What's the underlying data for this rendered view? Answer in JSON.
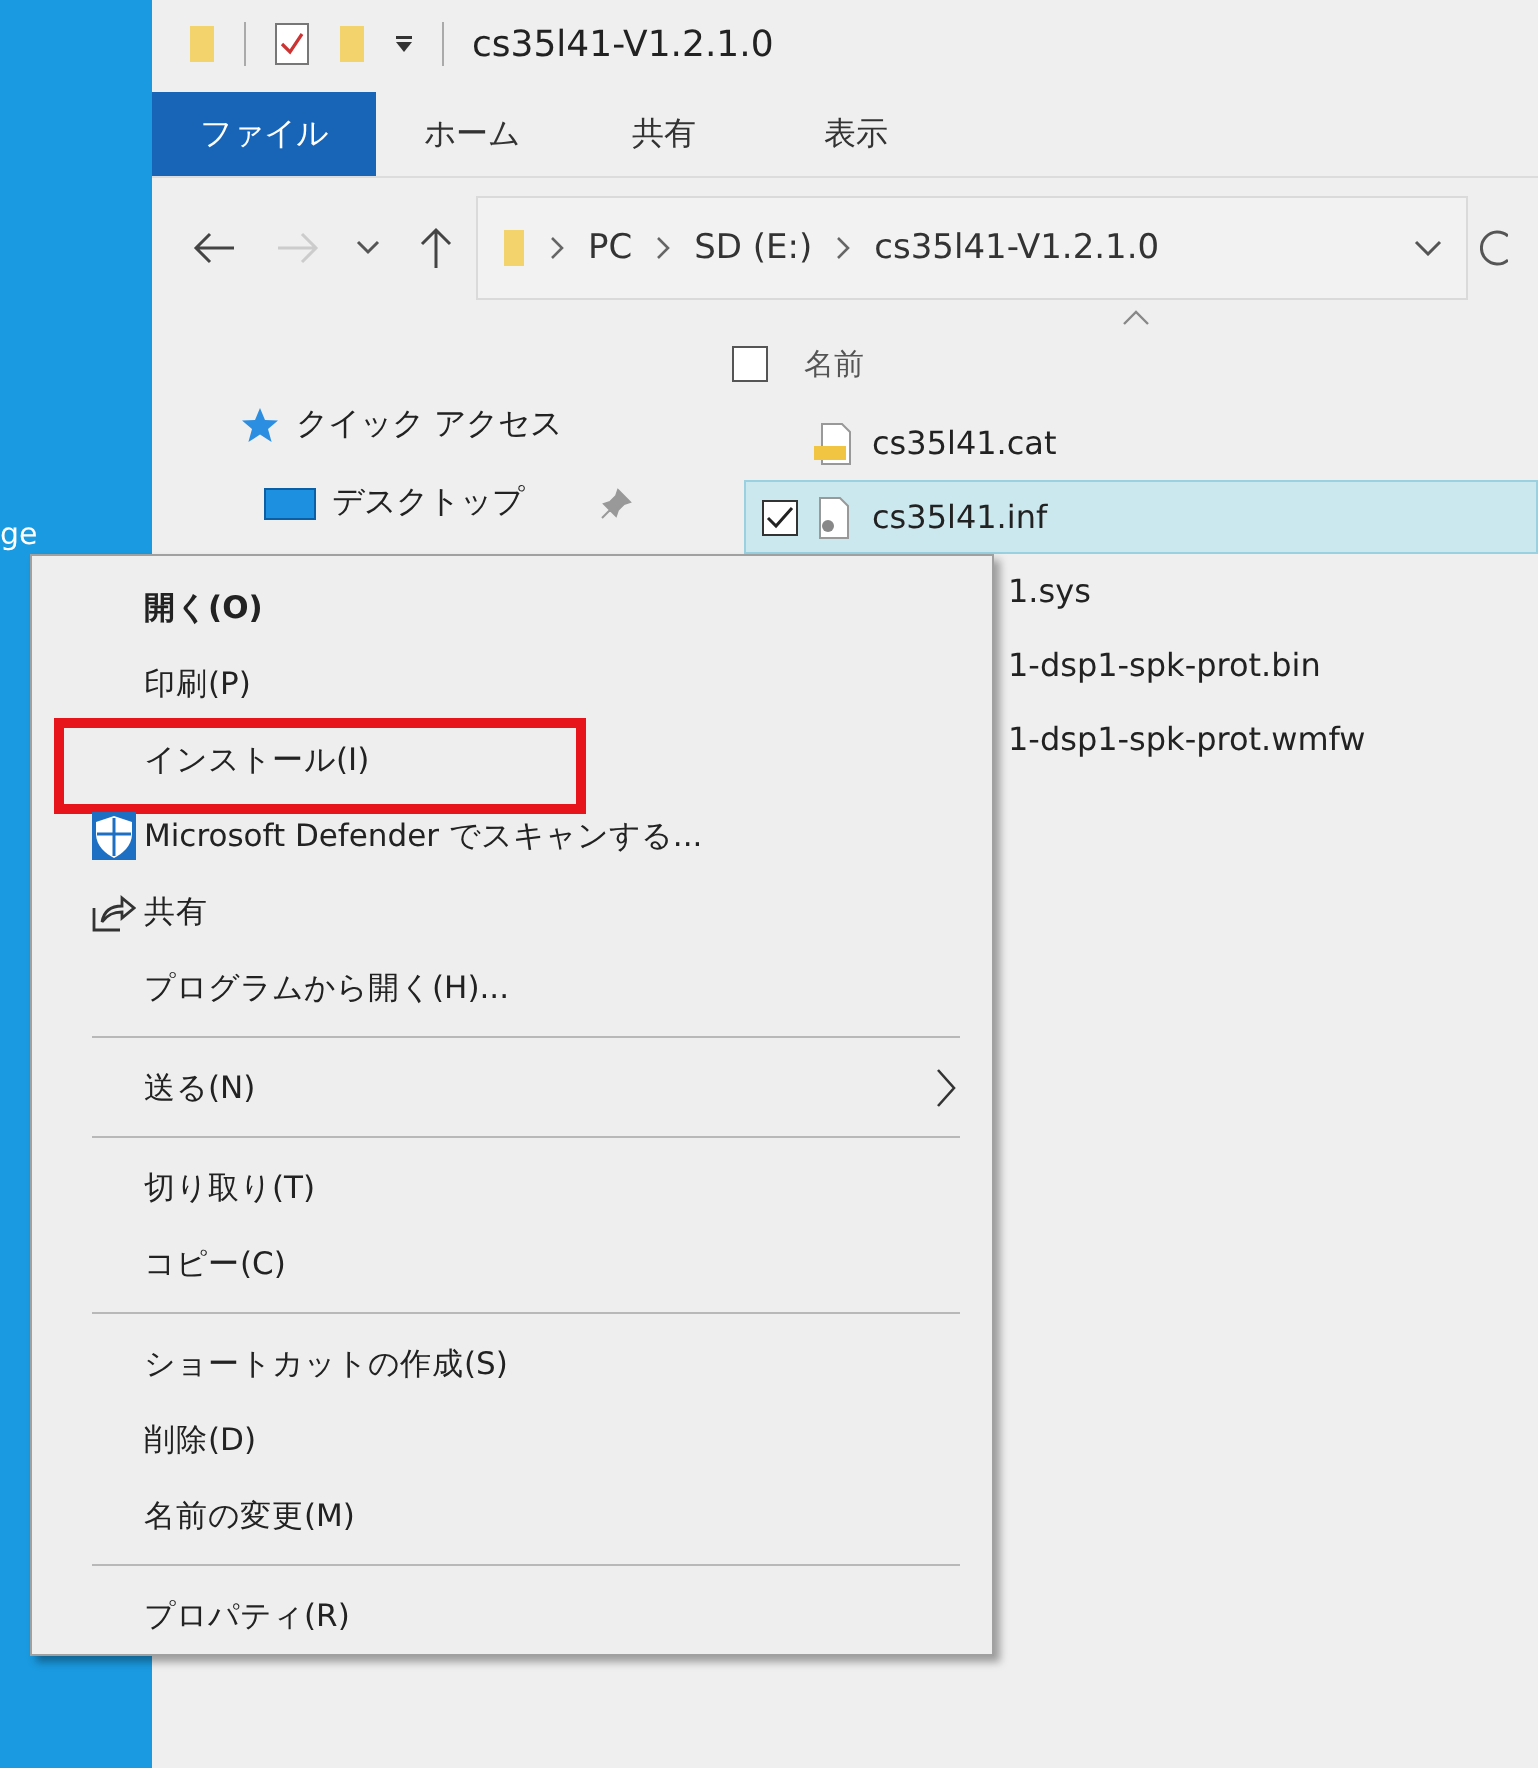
{
  "desktop": {
    "icon_label": "ge"
  },
  "window": {
    "title": "cs35l41-V1.2.1.0"
  },
  "ribbon_tabs": [
    {
      "label": "ファイル",
      "selected": true
    },
    {
      "label": "ホーム",
      "selected": false
    },
    {
      "label": "共有",
      "selected": false
    },
    {
      "label": "表示",
      "selected": false
    }
  ],
  "address_bar": {
    "crumbs": [
      "PC",
      "SD (E:)",
      "cs35l41-V1.2.1.0"
    ]
  },
  "navigation": [
    {
      "label": "クイック アクセス",
      "kind": "star"
    },
    {
      "label": "デスクトップ",
      "kind": "desktop",
      "pinned": true
    }
  ],
  "file_list": {
    "column": "名前",
    "all_checked": false,
    "rows": [
      {
        "name": "cs35l41.cat",
        "kind": "catalog",
        "selected": false,
        "checked": false
      },
      {
        "name": "cs35l41.inf",
        "kind": "settings",
        "selected": true,
        "checked": true
      },
      {
        "name": "1.sys",
        "kind": "covered",
        "selected": false,
        "checked": false
      },
      {
        "name": "1-dsp1-spk-prot.bin",
        "kind": "covered",
        "selected": false,
        "checked": false
      },
      {
        "name": "1-dsp1-spk-prot.wmfw",
        "kind": "covered",
        "selected": false,
        "checked": false
      }
    ]
  },
  "context_menu": [
    {
      "kind": "item",
      "label": "開く(O)",
      "bold": true
    },
    {
      "kind": "item",
      "label": "印刷(P)"
    },
    {
      "kind": "item",
      "label": "インストール(I)",
      "highlighted": true
    },
    {
      "kind": "defender",
      "label": "Microsoft Defender でスキャンする..."
    },
    {
      "kind": "share",
      "label": "共有"
    },
    {
      "kind": "item",
      "label": "プログラムから開く(H)..."
    },
    {
      "kind": "separator"
    },
    {
      "kind": "submenu",
      "label": "送る(N)"
    },
    {
      "kind": "separator"
    },
    {
      "kind": "item",
      "label": "切り取り(T)"
    },
    {
      "kind": "item",
      "label": "コピー(C)"
    },
    {
      "kind": "separator"
    },
    {
      "kind": "item",
      "label": "ショートカットの作成(S)"
    },
    {
      "kind": "item",
      "label": "削除(D)"
    },
    {
      "kind": "item",
      "label": "名前の変更(M)"
    },
    {
      "kind": "separator"
    },
    {
      "kind": "item",
      "label": "プロパティ(R)"
    }
  ]
}
